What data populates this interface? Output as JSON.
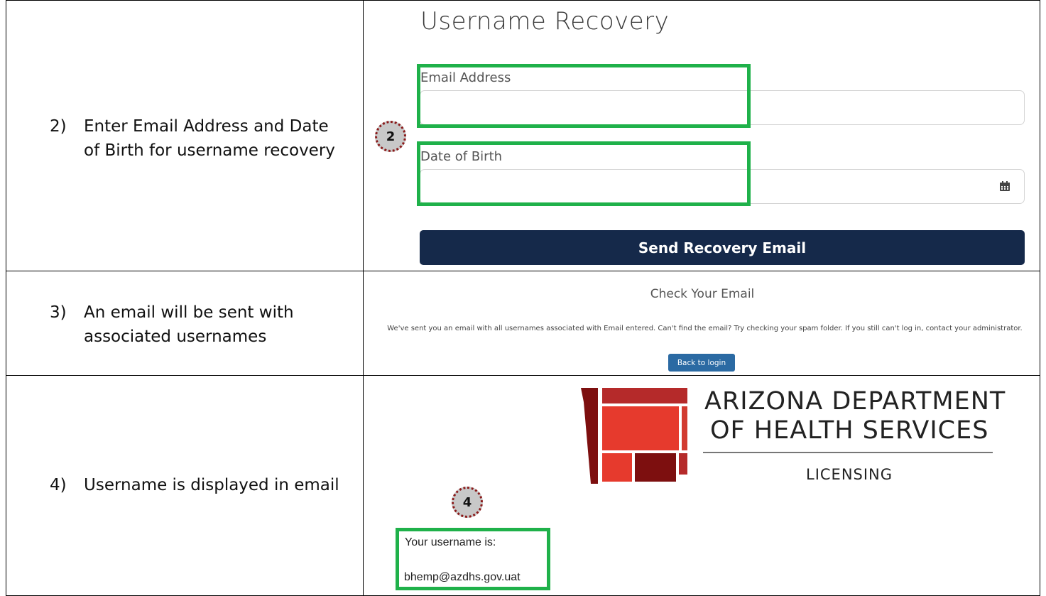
{
  "rows": [
    {
      "num": "2)",
      "line1": "Enter Email Address and Date",
      "line2": "of Birth for username recovery"
    },
    {
      "num": "3)",
      "line1": "An email will be sent with",
      "line2": "associated usernames"
    },
    {
      "num": "4)",
      "line1": "Username is displayed in email",
      "line2": ""
    }
  ],
  "recovery": {
    "title": "Username Recovery",
    "email_label": "Email Address",
    "email_value": "",
    "dob_label": "Date of Birth",
    "dob_value": "",
    "send_button": "Send Recovery Email",
    "marker": "2"
  },
  "check_email": {
    "title": "Check Your Email",
    "message": "We've sent you an email with all usernames associated with Email entered. Can't find the email? Try checking your spam folder. If you still can't log in, contact your administrator.",
    "back_button": "Back to login"
  },
  "email_view": {
    "logo_line1": "ARIZONA DEPARTMENT",
    "logo_line2": "OF HEALTH SERVICES",
    "logo_line3": "LICENSING",
    "marker": "4",
    "username_label": "Your username is:",
    "username_value": "bhemp@azdhs.gov.uat"
  },
  "colors": {
    "navy_button": "#15294a",
    "blue_button": "#2b6aa3",
    "highlight_green": "#1fb14a",
    "marker_dots": "#8a1a1a"
  }
}
